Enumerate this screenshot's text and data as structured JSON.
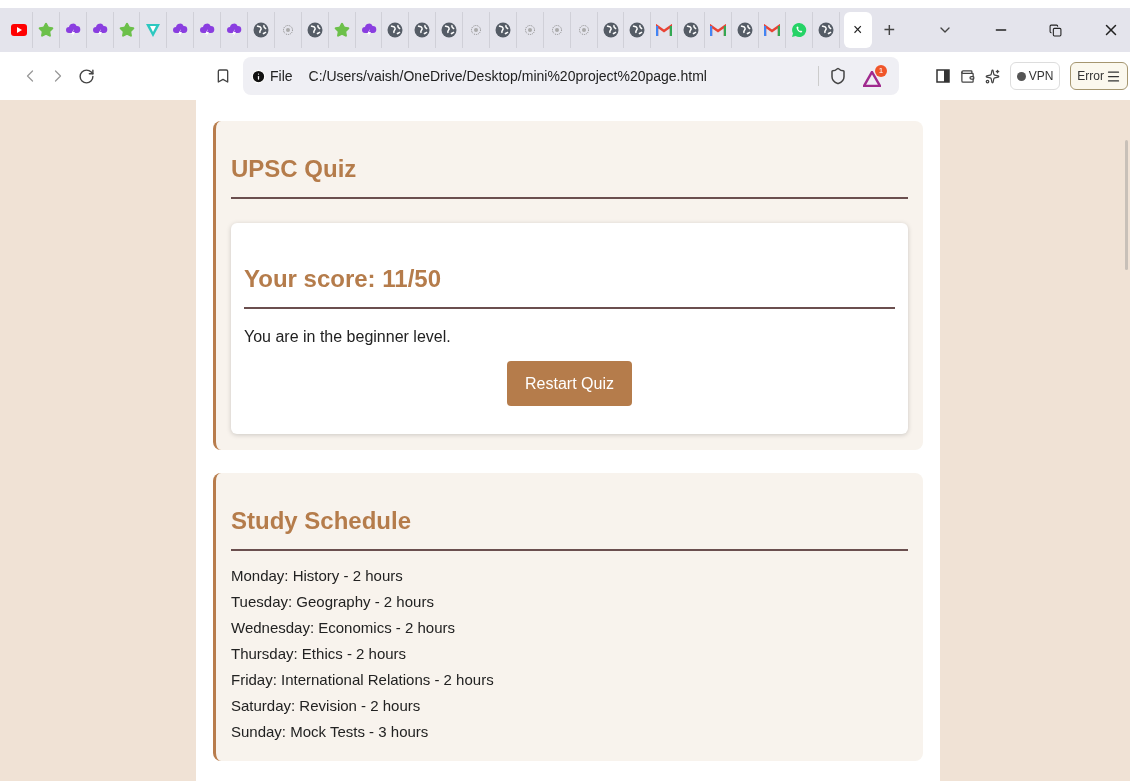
{
  "browser": {
    "tabs": [
      {
        "kind": "youtube",
        "selected": false
      },
      {
        "kind": "star",
        "selected": false
      },
      {
        "kind": "cloud",
        "selected": false
      },
      {
        "kind": "cloud",
        "selected": false
      },
      {
        "kind": "star",
        "selected": false
      },
      {
        "kind": "vee",
        "selected": false
      },
      {
        "kind": "cloud",
        "selected": false
      },
      {
        "kind": "cloud",
        "selected": false
      },
      {
        "kind": "cloud",
        "selected": false
      },
      {
        "kind": "globe",
        "selected": false
      },
      {
        "kind": "dot",
        "selected": false
      },
      {
        "kind": "globe",
        "selected": false
      },
      {
        "kind": "star",
        "selected": false
      },
      {
        "kind": "cloud",
        "selected": false
      },
      {
        "kind": "globe",
        "selected": false
      },
      {
        "kind": "globe",
        "selected": false
      },
      {
        "kind": "globe",
        "selected": false
      },
      {
        "kind": "dot",
        "selected": false
      },
      {
        "kind": "globe",
        "selected": false
      },
      {
        "kind": "dot",
        "selected": false
      },
      {
        "kind": "dot",
        "selected": false
      },
      {
        "kind": "dot",
        "selected": false
      },
      {
        "kind": "globe",
        "selected": false
      },
      {
        "kind": "globe",
        "selected": false
      },
      {
        "kind": "gmail",
        "selected": false
      },
      {
        "kind": "globe",
        "selected": false
      },
      {
        "kind": "gmail",
        "selected": false
      },
      {
        "kind": "globe",
        "selected": false
      },
      {
        "kind": "gmail",
        "selected": false
      },
      {
        "kind": "whatsapp",
        "selected": false
      },
      {
        "kind": "globe",
        "selected": false
      },
      {
        "kind": "blank",
        "selected": true,
        "close": "×"
      }
    ],
    "new_tab": "+",
    "address": {
      "scheme": "File",
      "url": "C:/Users/vaish/OneDrive/Desktop/mini%20project%20page.html",
      "rewards_badge": "1"
    },
    "vpn": "VPN",
    "error": "Error"
  },
  "quiz": {
    "title": "UPSC Quiz",
    "score": "Your score: 11/50",
    "message": "You are in the beginner level.",
    "button": "Restart Quiz"
  },
  "schedule": {
    "title": "Study Schedule",
    "items": [
      "Monday: History - 2 hours",
      "Tuesday: Geography - 2 hours",
      "Wednesday: Economics - 2 hours",
      "Thursday: Ethics - 2 hours",
      "Friday: International Relations - 2 hours",
      "Saturday: Revision - 2 hours",
      "Sunday: Mock Tests - 3 hours"
    ]
  }
}
